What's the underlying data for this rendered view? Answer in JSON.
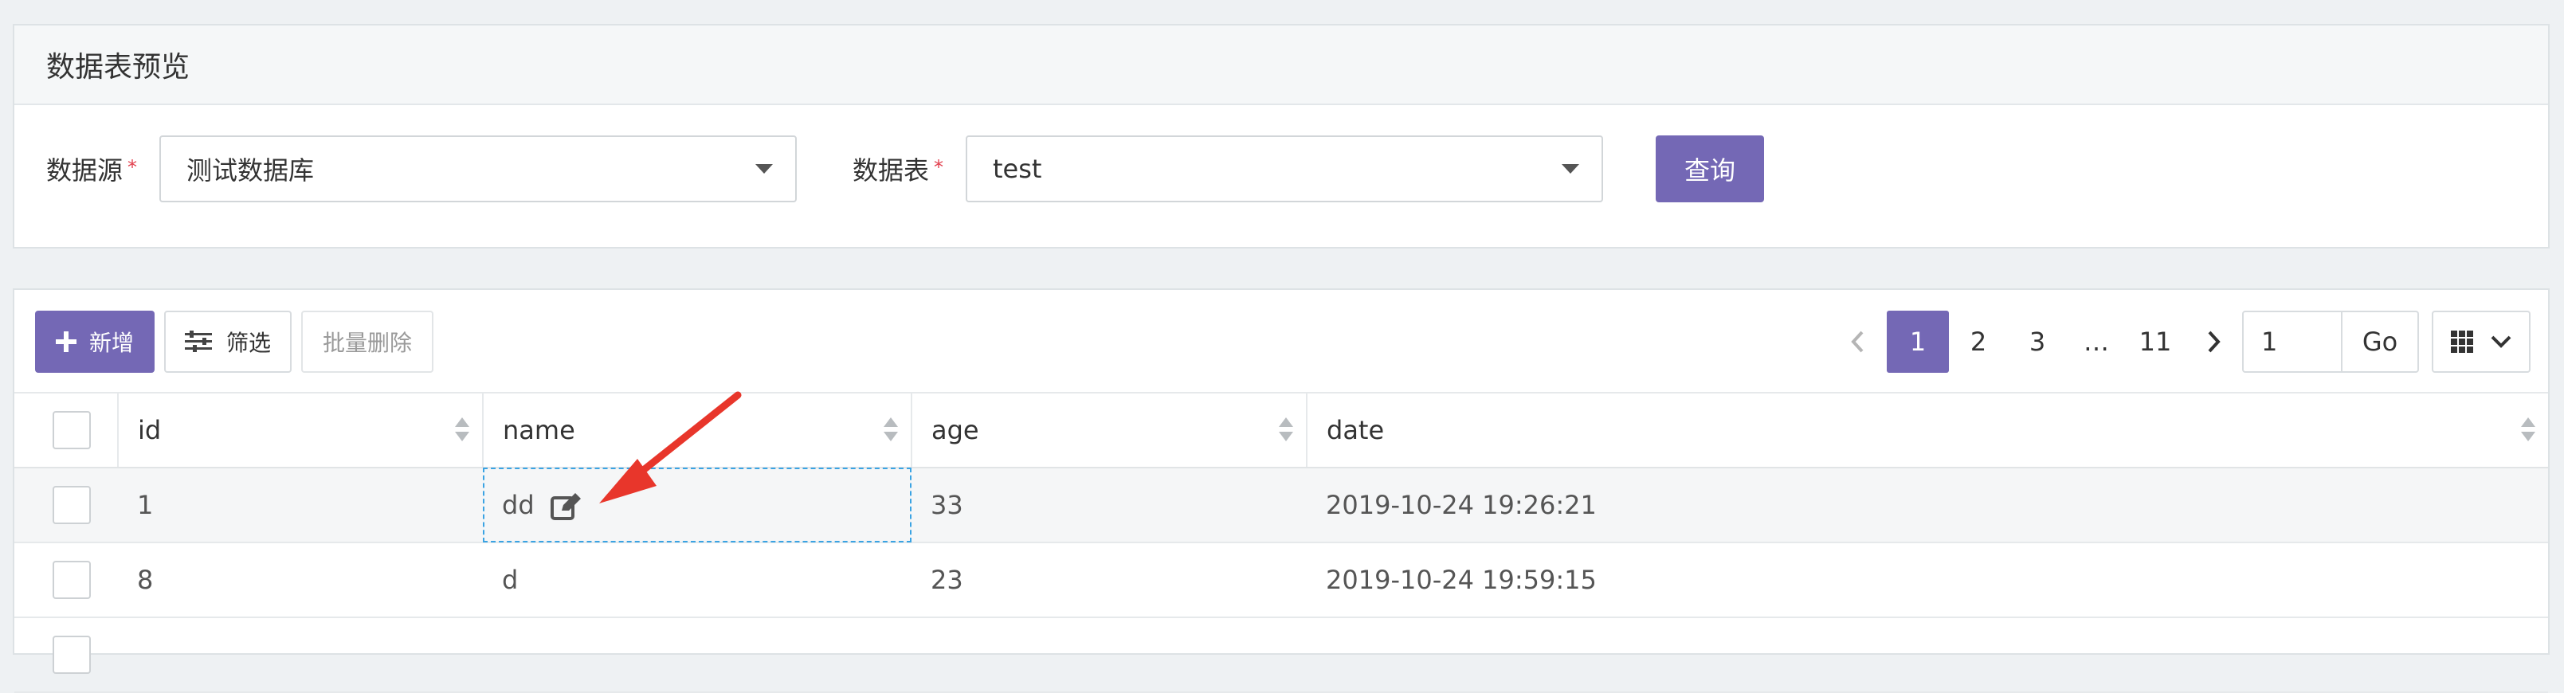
{
  "panel_title": "数据表预览",
  "form": {
    "datasource_label": "数据源",
    "datasource_value": "测试数据库",
    "table_label": "数据表",
    "table_value": "test",
    "required_mark": "*",
    "query_button": "查询"
  },
  "toolbar": {
    "add_label": "新增",
    "filter_label": "筛选",
    "batch_delete_label": "批量删除"
  },
  "pagination": {
    "pages": [
      "1",
      "2",
      "3",
      "…",
      "11"
    ],
    "current": "1",
    "jump_value": "1",
    "go_label": "Go"
  },
  "table": {
    "columns": [
      "id",
      "name",
      "age",
      "date"
    ],
    "rows": [
      {
        "id": "1",
        "name": "dd",
        "age": "33",
        "date": "2019-10-24 19:26:21"
      },
      {
        "id": "8",
        "name": "d",
        "age": "23",
        "date": "2019-10-24 19:59:15"
      }
    ]
  },
  "colors": {
    "primary": "#7468b5",
    "annotation_arrow": "#e8362b",
    "edit_outline": "#3aa3e3"
  }
}
